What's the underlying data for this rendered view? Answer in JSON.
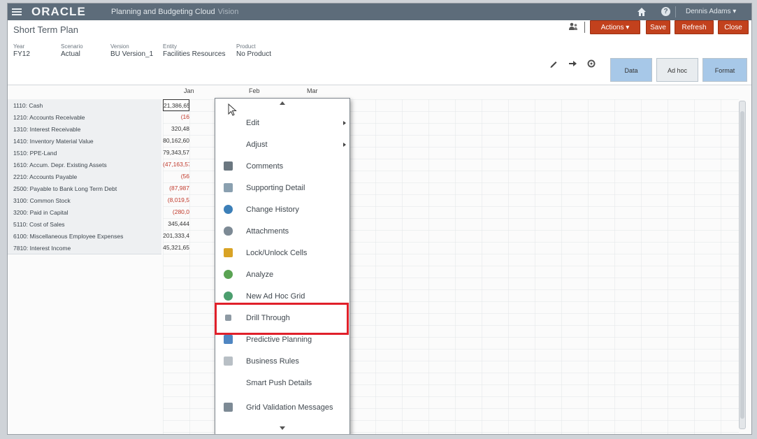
{
  "app": {
    "logo": "ORACLE",
    "title": "Planning and Budgeting Cloud",
    "subtitle": "Vision",
    "user": "Dennis Adams"
  },
  "page": {
    "title": "Short Term Plan",
    "buttons": {
      "actions": "Actions",
      "save": "Save",
      "refresh": "Refresh",
      "close": "Close"
    },
    "tabs": {
      "data": "Data",
      "adhoc": "Ad hoc",
      "format": "Format"
    }
  },
  "pov": [
    {
      "label": "Year",
      "value": "FY12"
    },
    {
      "label": "Scenario",
      "value": "Actual"
    },
    {
      "label": "Version",
      "value": "BU Version_1"
    },
    {
      "label": "Entity",
      "value": "Facilities Resources"
    },
    {
      "label": "Product",
      "value": "No Product"
    }
  ],
  "grid": {
    "columns": [
      "Jan",
      "Feb",
      "Mar"
    ],
    "rows": [
      {
        "label": "1110: Cash",
        "jan": "21,386,65"
      },
      {
        "label": "1210: Accounts Receivable",
        "jan": "(16"
      },
      {
        "label": "1310: Interest Receivable",
        "jan": "320,48"
      },
      {
        "label": "1410: Inventory Material Value",
        "jan": "80,162,60"
      },
      {
        "label": "1510: PPE-Land",
        "jan": "79,343,57"
      },
      {
        "label": "1610: Accum. Depr. Existing Assets",
        "jan": "(47,163,57"
      },
      {
        "label": "2210: Accounts Payable",
        "jan": "(56"
      },
      {
        "label": "2500: Payable to Bank Long Term Debt",
        "jan": "(87,987"
      },
      {
        "label": "3100: Common Stock",
        "jan": "(8,019,5"
      },
      {
        "label": "3200: Paid in Capital",
        "jan": "(280,0"
      },
      {
        "label": "5110: Cost of Sales",
        "jan": "345,444"
      },
      {
        "label": "6100: Miscellaneous Employee Expenses",
        "jan": "201,333,4"
      },
      {
        "label": "7810: Interest Income",
        "jan": "45,321,65"
      }
    ]
  },
  "context_menu": {
    "items": [
      {
        "label": "Edit",
        "icon": "none",
        "submenu": true
      },
      {
        "label": "Adjust",
        "icon": "none",
        "submenu": true
      },
      {
        "label": "Comments",
        "icon": "comment-icon"
      },
      {
        "label": "Supporting Detail",
        "icon": "supporting-detail-icon"
      },
      {
        "label": "Change History",
        "icon": "history-icon"
      },
      {
        "label": "Attachments",
        "icon": "paperclip-icon"
      },
      {
        "label": "Lock/Unlock Cells",
        "icon": "lock-icon"
      },
      {
        "label": "Analyze",
        "icon": "analyze-icon"
      },
      {
        "label": "New Ad Hoc Grid",
        "icon": "adhoc-grid-icon"
      },
      {
        "label": "Drill Through",
        "icon": "drill-through-icon"
      },
      {
        "label": "Predictive Planning",
        "icon": "predictive-icon"
      },
      {
        "label": "Business Rules",
        "icon": "rules-icon"
      },
      {
        "label": "Smart Push Details",
        "icon": "none"
      },
      {
        "label": "Grid Validation Messages",
        "icon": "validation-icon"
      }
    ],
    "highlighted": "Drill Through"
  },
  "colors": {
    "topbar": "#5d6c7a",
    "accent_red": "#c2411d",
    "highlight": "#e0202a",
    "tab_data": "#9fc3e6",
    "tab_format": "#9fc3e6"
  }
}
